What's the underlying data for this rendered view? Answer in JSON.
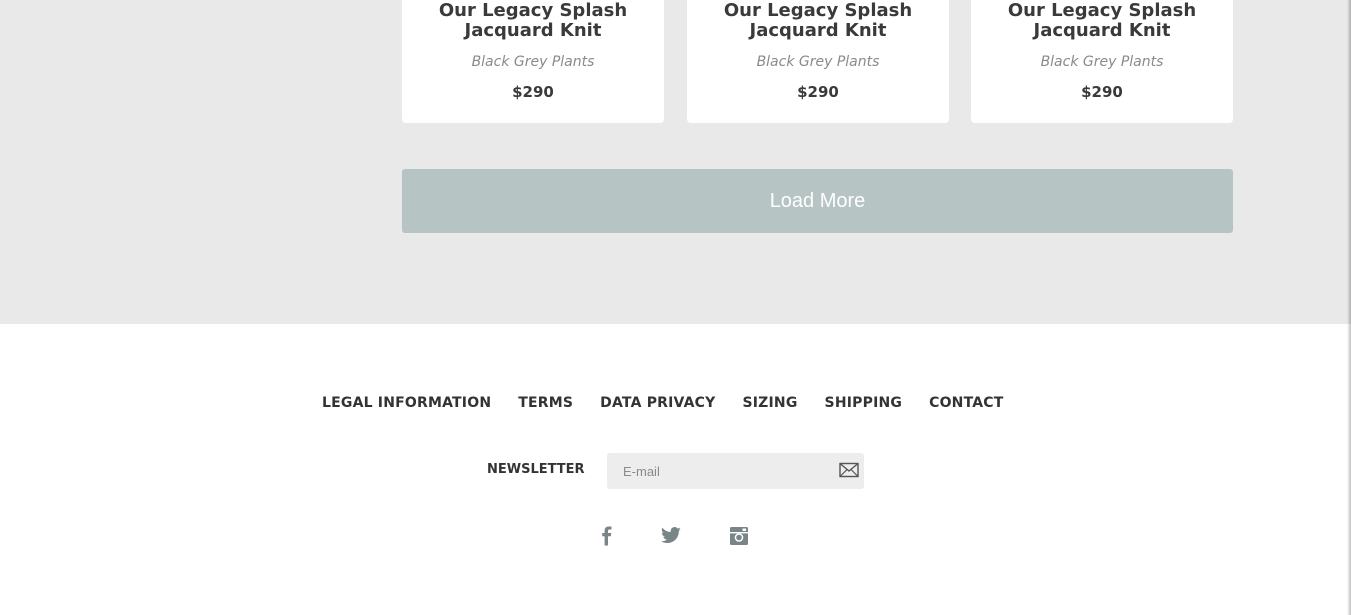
{
  "products": [
    {
      "title": "Our Legacy Splash Jacquard Knit",
      "variant": "Black Grey Plants",
      "price": "$290"
    },
    {
      "title": "Our Legacy Splash Jacquard Knit",
      "variant": "Black Grey Plants",
      "price": "$290"
    },
    {
      "title": "Our Legacy Splash Jacquard Knit",
      "variant": "Black Grey Plants",
      "price": "$290"
    }
  ],
  "load_more": {
    "label": "Load More"
  },
  "footer": {
    "links": [
      "LEGAL INFORMATION",
      "TERMS",
      "DATA PRIVACY",
      "SIZING",
      "SHIPPING",
      "CONTACT"
    ],
    "newsletter": {
      "label": "NEWSLETTER",
      "placeholder": "E-mail",
      "value": ""
    },
    "social": [
      "facebook-icon",
      "twitter-icon",
      "instagram-icon"
    ]
  },
  "colors": {
    "background_upper": "#e9e9e9",
    "button": "#b6c4c4",
    "text_dark": "#333333",
    "text_muted": "#8a8a8a",
    "icon": "#7a8588"
  }
}
